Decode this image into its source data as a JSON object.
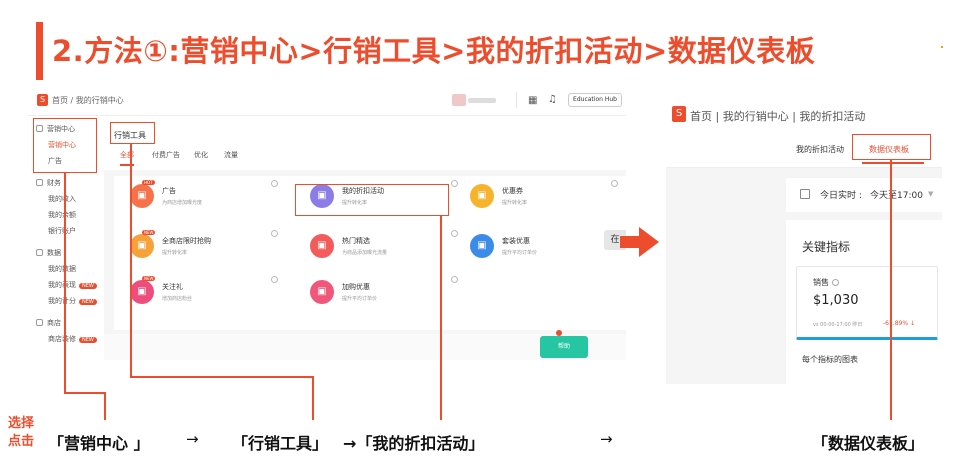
{
  "title": "2.方法①:营销中心>行销工具>我的折扣活动>数据仪表板",
  "shot1": {
    "logo": "S",
    "breadcrumb": "首页 / 我的行销中心",
    "icons": {
      "grid": "apps-icon",
      "bell": "bell-icon"
    },
    "edu_button": "Education Hub",
    "sidebar": [
      {
        "label": "营销中心",
        "icon": true
      },
      {
        "label": "营销中心",
        "sub": true,
        "red": true
      },
      {
        "label": "广告",
        "sub": true
      },
      {
        "label": "财务",
        "icon": true
      },
      {
        "label": "我的收入",
        "sub": true
      },
      {
        "label": "我的余额",
        "sub": true
      },
      {
        "label": "银行账户",
        "sub": true
      },
      {
        "label": "数据",
        "icon": true
      },
      {
        "label": "我的数据",
        "sub": true
      },
      {
        "label": "我的表现",
        "sub": true,
        "tag": "NEW"
      },
      {
        "label": "我的计分",
        "sub": true,
        "tag": "NEW"
      },
      {
        "label": "商店",
        "icon": true
      },
      {
        "label": "商店装修",
        "sub": true,
        "tag": "NEW"
      }
    ],
    "header_title": "行销工具",
    "tabs": [
      "全部",
      "付费广告",
      "优化",
      "流量"
    ],
    "tiles": [
      {
        "name": "广告",
        "desc": "为商店增加曝光度",
        "color": "#f6724a",
        "icon": "ad-icon",
        "tag": "HOT"
      },
      {
        "name": "我的折扣活动",
        "desc": "提升转化率",
        "color": "#8b7ce8",
        "icon": "discount-icon"
      },
      {
        "name": "优惠券",
        "desc": "提升转化率",
        "color": "#f7b32b",
        "icon": "coupon-icon"
      },
      {
        "name": "全商店限时抢购",
        "desc": "提升转化率",
        "color": "#f7a13a",
        "icon": "flash-sale-icon",
        "tag": "NEW"
      },
      {
        "name": "热门精选",
        "desc": "为商品添加曝光流量",
        "color": "#f45b5b",
        "icon": "hot-icon"
      },
      {
        "name": "套装优惠",
        "desc": "提升平均订单价",
        "color": "#3b8be8",
        "icon": "bundle-icon"
      },
      {
        "name": "关注礼",
        "desc": "增加商店粉丝",
        "color": "#ee4d7d",
        "icon": "gift-icon",
        "tag": "NEW"
      },
      {
        "name": "加购优惠",
        "desc": "提升平均订单价",
        "color": "#f0577a",
        "icon": "addon-icon"
      }
    ],
    "help_button": "帮助",
    "float_button": "在"
  },
  "shot2": {
    "logo": "S",
    "breadcrumb": "首页 | 我的行销中心 | 我的折扣活动",
    "tab1": "我的折扣活动",
    "tab2": "数据仪表板",
    "realtime_label": "今日实时 :",
    "realtime_value": "今天至17:00",
    "kpi_title": "关键指标",
    "card_label": "销售",
    "card_value": "$1,030",
    "card_compare": "vs 00:00-17:00 昨日",
    "card_change": "-61.89%",
    "sub_title": "每个指标的图表"
  },
  "captions": {
    "c1": "「营销中心 」",
    "a1": "→",
    "c2": "「行销工具」",
    "c3": "→「我的折扣活动」",
    "a2": "→",
    "c4": "「数据仪表板」",
    "side1": "选择",
    "side2": "点击"
  },
  "colors": {
    "accent": "#ee4d2d",
    "teal": "#26c6a2",
    "blue": "#1e9fd8"
  }
}
